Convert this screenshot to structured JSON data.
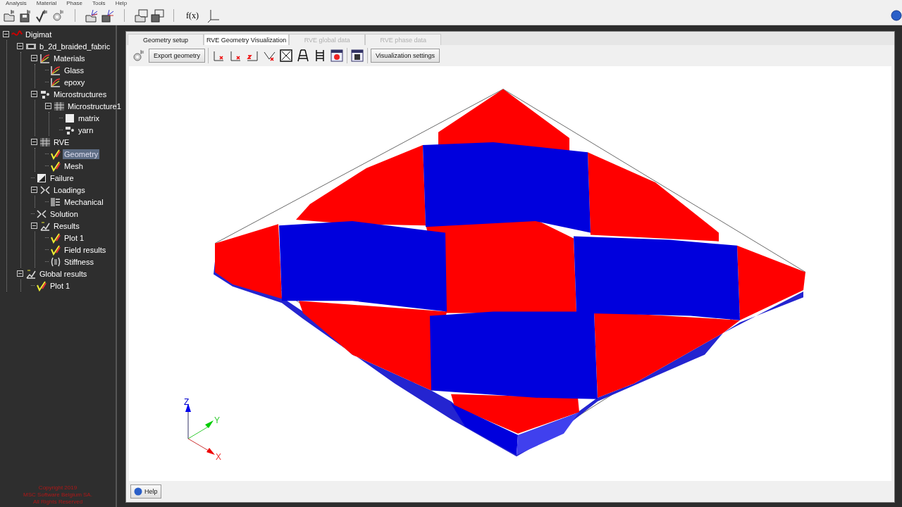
{
  "menu": [
    "Analysis",
    "Material",
    "Phase",
    "Tools",
    "Help"
  ],
  "toolbar": {
    "formula_button": "f(x)"
  },
  "tree": [
    {
      "label": "Digimat",
      "kind": "root",
      "expanded": true,
      "selected": false,
      "children": [
        {
          "label": "b_2d_braided_fabric",
          "kind": "model",
          "expanded": true,
          "selected": false,
          "children": [
            {
              "label": "Materials",
              "kind": "graph",
              "expanded": true,
              "selected": false,
              "children": [
                {
                  "label": "Glass",
                  "kind": "graph",
                  "selected": false
                },
                {
                  "label": "epoxy",
                  "kind": "graph",
                  "selected": false
                }
              ]
            },
            {
              "label": "Microstructures",
              "kind": "micro",
              "expanded": true,
              "selected": false,
              "children": [
                {
                  "label": "Microstructure1",
                  "kind": "grid",
                  "expanded": true,
                  "selected": false,
                  "children": [
                    {
                      "label": "matrix",
                      "kind": "square",
                      "selected": false
                    },
                    {
                      "label": "yarn",
                      "kind": "micro",
                      "selected": false
                    }
                  ]
                }
              ]
            },
            {
              "label": "RVE",
              "kind": "grid",
              "expanded": true,
              "selected": false,
              "children": [
                {
                  "label": "Geometry",
                  "kind": "check",
                  "selected": true
                },
                {
                  "label": "Mesh",
                  "kind": "check",
                  "selected": false
                }
              ]
            },
            {
              "label": "Failure",
              "kind": "failure",
              "selected": false
            },
            {
              "label": "Loadings",
              "kind": "arrows",
              "expanded": true,
              "selected": false,
              "children": [
                {
                  "label": "Mechanical",
                  "kind": "load",
                  "selected": false
                }
              ]
            },
            {
              "label": "Solution",
              "kind": "arrows",
              "selected": false
            },
            {
              "label": "Results",
              "kind": "results",
              "expanded": true,
              "selected": false,
              "children": [
                {
                  "label": "Plot 1",
                  "kind": "check",
                  "selected": false
                },
                {
                  "label": "Field results",
                  "kind": "check",
                  "selected": false
                },
                {
                  "label": "Stiffness",
                  "kind": "stiffness",
                  "selected": false
                }
              ]
            }
          ]
        },
        {
          "label": "Global results",
          "kind": "results",
          "expanded": true,
          "selected": false,
          "children": [
            {
              "label": "Plot 1",
              "kind": "check",
              "selected": false
            }
          ]
        }
      ]
    }
  ],
  "copyright": [
    "Copyright 2019",
    "MSC Software Belgium SA.",
    "All Rights Reserved"
  ],
  "tabs": [
    {
      "label": "Geometry setup",
      "selected": false,
      "disabled": false
    },
    {
      "label": "RVE Geometry Visualization",
      "selected": true,
      "disabled": false
    },
    {
      "label": "RVE global data",
      "selected": false,
      "disabled": true
    },
    {
      "label": "RVE phase data",
      "selected": false,
      "disabled": true
    }
  ],
  "panel_toolbar": {
    "export_button": "Export geometry",
    "settings_button": "Visualization settings"
  },
  "axes": {
    "z": "Z",
    "y": "Y",
    "x": "X"
  },
  "help_button": "Help"
}
